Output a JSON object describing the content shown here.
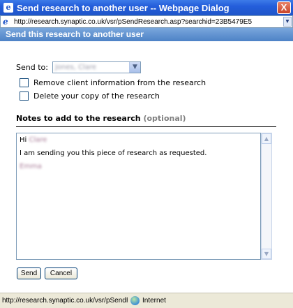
{
  "window": {
    "title": "Send research to another user -- Webpage Dialog",
    "close_label": "X"
  },
  "address": {
    "url": "http://research.synaptic.co.uk/vsr/pSendResearch.asp?searchid=23B5479E5",
    "dropdown_icon": "chevron-down-icon"
  },
  "section": {
    "header": "Send this research to another user"
  },
  "form": {
    "send_to_label": "Send to:",
    "send_to_value": "Jones, Clare",
    "options": [
      {
        "label": "Remove client information from the research",
        "checked": false
      },
      {
        "label": "Delete your copy of the research",
        "checked": false
      }
    ]
  },
  "notes": {
    "title": "Notes to add to the research",
    "optional": "(optional)",
    "greeting": "Hi",
    "greeting_name": "Clare",
    "body": "I am sending you this piece of research as requested.",
    "signature": "Emma"
  },
  "buttons": {
    "send": "Send",
    "cancel": "Cancel"
  },
  "status": {
    "url": "http://research.synaptic.co.uk/vsr/pSendRese",
    "zone": "Internet"
  },
  "colors": {
    "titlebar": "#245edb",
    "section_header": "#6b99d5",
    "statusbar": "#ece9d8"
  }
}
